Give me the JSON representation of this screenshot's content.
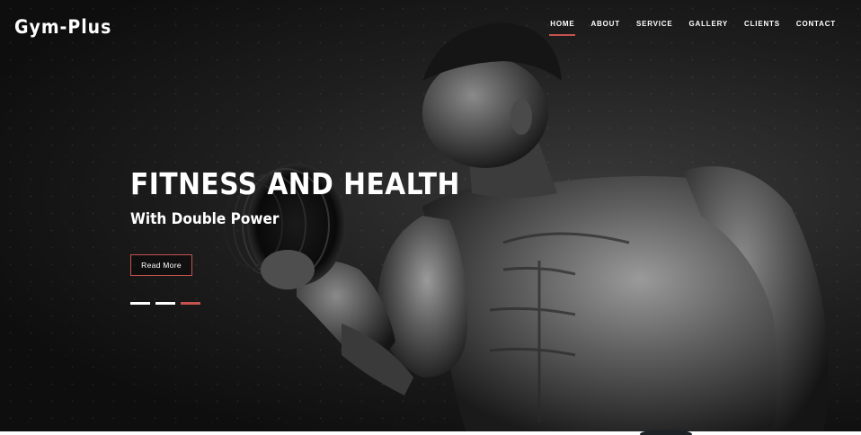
{
  "site": {
    "logo": "Gym-Plus"
  },
  "nav": {
    "items": [
      {
        "label": "HOME",
        "active": true
      },
      {
        "label": "ABOUT",
        "active": false
      },
      {
        "label": "SERVICE",
        "active": false
      },
      {
        "label": "GALLERY",
        "active": false
      },
      {
        "label": "CLIENTS",
        "active": false
      },
      {
        "label": "CONTACT",
        "active": false
      }
    ],
    "active_color": "#c5524e"
  },
  "hero": {
    "title": "FITNESS AND HEALTH",
    "subtitle": "With Double Power",
    "button_label": "Read More",
    "slides": {
      "count": 3,
      "active_index": 2
    }
  },
  "colors": {
    "accent": "#c5524e",
    "background": "#111111",
    "text": "#ffffff"
  }
}
